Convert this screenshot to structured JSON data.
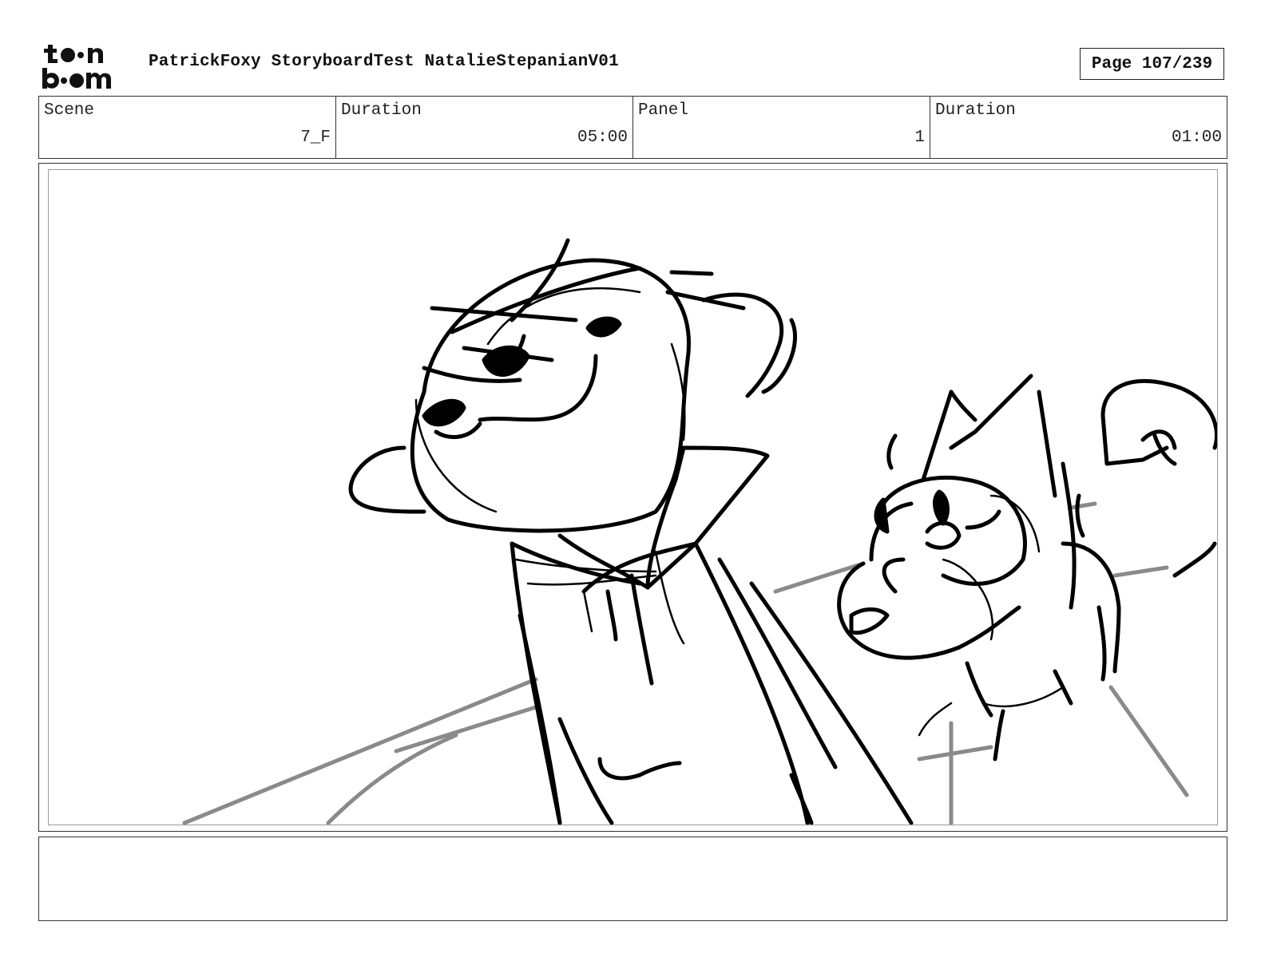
{
  "header": {
    "logo_text": "toon boom",
    "title": "PatrickFoxy StoryboardTest NatalieStepanianV01",
    "page_label": "Page 107/239"
  },
  "info": {
    "scene_label": "Scene",
    "scene_value": "7_F",
    "scene_duration_label": "Duration",
    "scene_duration_value": "05:00",
    "panel_label": "Panel",
    "panel_value": "1",
    "panel_duration_label": "Duration",
    "panel_duration_value": "01:00"
  },
  "notes": {
    "text": ""
  },
  "colors": {
    "ink": "#000000",
    "guide_gray": "#8a8a8a",
    "border": "#333333"
  }
}
